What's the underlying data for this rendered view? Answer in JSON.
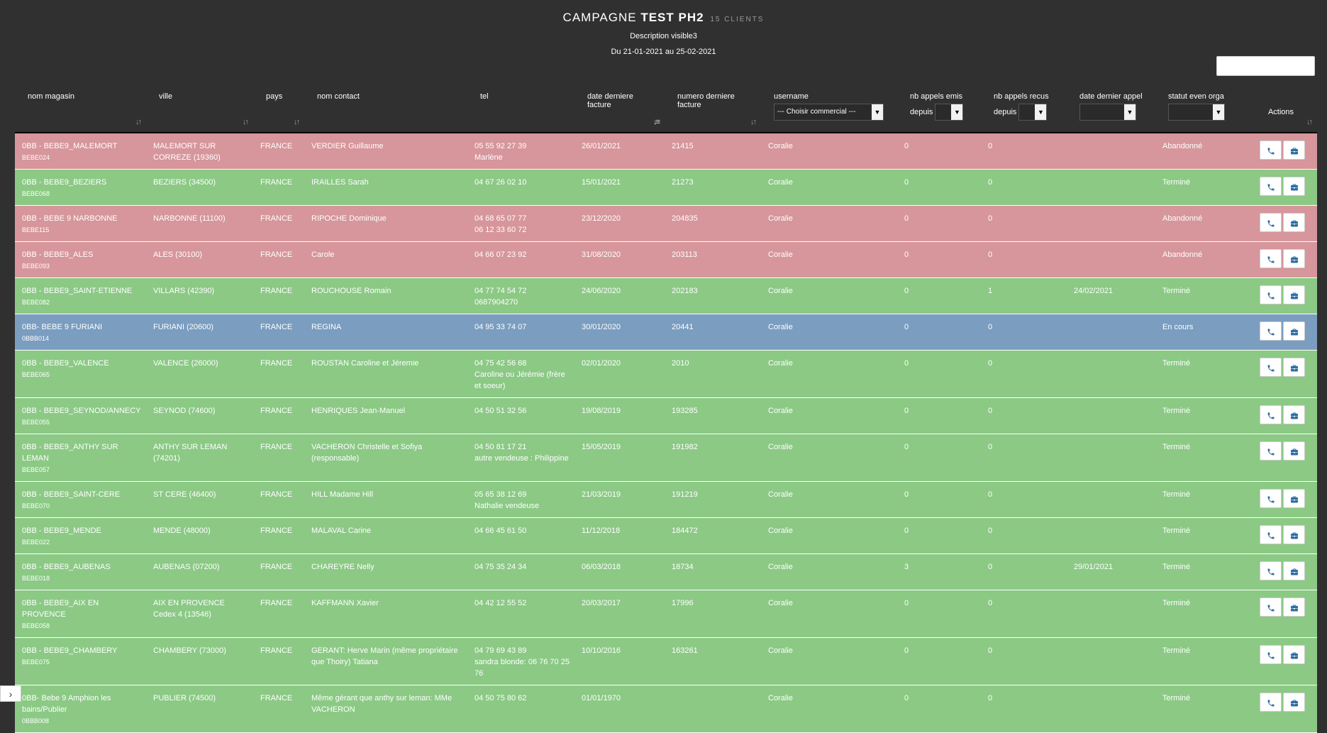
{
  "header": {
    "title_prefix": "CAMPAGNE",
    "title_name": "TEST PH2",
    "count": "15 CLIENTS",
    "description": "Description visible3",
    "dates": "Du 21-01-2021 au 25-02-2021"
  },
  "columns": {
    "nom_magasin": "nom magasin",
    "ville": "ville",
    "pays": "pays",
    "nom_contact": "nom contact",
    "tel": "tel",
    "date_derniere_facture": "date derniere facture",
    "numero_derniere_facture": "numero derniere facture",
    "username": "username",
    "username_select": "--- Choisir commercial ---",
    "nb_appels_emis": "nb appels emis",
    "nb_appels_emis_sub": "depuis",
    "nb_appels_recus": "nb appels recus",
    "nb_appels_recus_sub": "depuis",
    "date_dernier_appel": "date dernier appel",
    "statut": "statut even orga",
    "actions": "Actions"
  },
  "rows": [
    {
      "status": "red",
      "magasin": "0BB - BEBE9_MALEMORT",
      "code": "BEBE024",
      "ville": "MALEMORT SUR CORREZE (19360)",
      "pays": "FRANCE",
      "contact": "VERDIER Guillaume",
      "tel": "05 55 92 27 39",
      "tel2": "Marlène",
      "date_facture": "26/01/2021",
      "num_facture": "21415",
      "username": "Coralie",
      "emis": "0",
      "recus": "0",
      "dernier_appel": "",
      "statut": "Abandonné"
    },
    {
      "status": "green",
      "magasin": "0BB - BEBE9_BEZIERS",
      "code": "BEBE068",
      "ville": "BEZIERS (34500)",
      "pays": "FRANCE",
      "contact": "IRAILLES Sarah",
      "tel": "04 67 26 02 10",
      "tel2": "",
      "date_facture": "15/01/2021",
      "num_facture": "21273",
      "username": "Coralie",
      "emis": "0",
      "recus": "0",
      "dernier_appel": "",
      "statut": "Terminé"
    },
    {
      "status": "red",
      "magasin": "0BB - BEBE 9 NARBONNE",
      "code": "BEBE115",
      "ville": "NARBONNE (11100)",
      "pays": "FRANCE",
      "contact": "RIPOCHE Dominique",
      "tel": "04 68 65 07 77",
      "tel2": "06 12 33 60 72",
      "date_facture": "23/12/2020",
      "num_facture": "204835",
      "username": "Coralie",
      "emis": "0",
      "recus": "0",
      "dernier_appel": "",
      "statut": "Abandonné"
    },
    {
      "status": "red",
      "magasin": "0BB - BEBE9_ALES",
      "code": "BEBE093",
      "ville": "ALES (30100)",
      "pays": "FRANCE",
      "contact": "Carole",
      "tel": "04 66 07 23 92",
      "tel2": "",
      "date_facture": "31/08/2020",
      "num_facture": "203113",
      "username": "Coralie",
      "emis": "0",
      "recus": "0",
      "dernier_appel": "",
      "statut": "Abandonné"
    },
    {
      "status": "green",
      "magasin": "0BB - BEBE9_SAINT-ETIENNE",
      "code": "BEBE082",
      "ville": "VILLARS (42390)",
      "pays": "FRANCE",
      "contact": "ROUCHOUSE Romain",
      "tel": "04 77 74 54 72",
      "tel2": "0687904270",
      "date_facture": "24/06/2020",
      "num_facture": "202183",
      "username": "Coralie",
      "emis": "0",
      "recus": "1",
      "dernier_appel": "24/02/2021",
      "statut": "Terminé"
    },
    {
      "status": "blue",
      "magasin": "0BB- BEBE 9 FURIANI",
      "code": "0BBB014",
      "ville": "FURIANI (20600)",
      "pays": "FRANCE",
      "contact": "REGINA",
      "tel": "04 95 33 74 07",
      "tel2": "",
      "date_facture": "30/01/2020",
      "num_facture": "20441",
      "username": "Coralie",
      "emis": "0",
      "recus": "0",
      "dernier_appel": "",
      "statut": "En cours"
    },
    {
      "status": "green",
      "magasin": "0BB - BEBE9_VALENCE",
      "code": "BEBE065",
      "ville": "VALENCE (26000)",
      "pays": "FRANCE",
      "contact": "ROUSTAN Caroline et Jéremie",
      "tel": "04 75 42 56 68",
      "tel2": "Caroline ou Jérémie (frère et soeur)",
      "date_facture": "02/01/2020",
      "num_facture": "2010",
      "username": "Coralie",
      "emis": "0",
      "recus": "0",
      "dernier_appel": "",
      "statut": "Terminé"
    },
    {
      "status": "green",
      "magasin": "0BB - BEBE9_SEYNOD/ANNECY",
      "code": "BEBE055",
      "ville": "SEYNOD (74600)",
      "pays": "FRANCE",
      "contact": "HENRIQUES Jean-Manuel",
      "tel": "04 50 51 32 56",
      "tel2": "",
      "date_facture": "19/08/2019",
      "num_facture": "193285",
      "username": "Coralie",
      "emis": "0",
      "recus": "0",
      "dernier_appel": "",
      "statut": "Terminé"
    },
    {
      "status": "green",
      "magasin": "0BB - BEBE9_ANTHY SUR LEMAN",
      "code": "BEBE057",
      "ville": "ANTHY SUR LEMAN (74201)",
      "pays": "FRANCE",
      "contact": "VACHERON Christelle et Sofiya (responsable)",
      "tel": "04 50 81 17 21",
      "tel2": "autre vendeuse : Philippine",
      "date_facture": "15/05/2019",
      "num_facture": "191982",
      "username": "Coralie",
      "emis": "0",
      "recus": "0",
      "dernier_appel": "",
      "statut": "Terminé"
    },
    {
      "status": "green",
      "magasin": "0BB - BEBE9_SAINT-CERE",
      "code": "BEBE070",
      "ville": "ST CERE (46400)",
      "pays": "FRANCE",
      "contact": "HILL Madame Hill",
      "tel": "05 65 38 12 69",
      "tel2": "Nathalie vendeuse",
      "date_facture": "21/03/2019",
      "num_facture": "191219",
      "username": "Coralie",
      "emis": "0",
      "recus": "0",
      "dernier_appel": "",
      "statut": "Terminé"
    },
    {
      "status": "green",
      "magasin": "0BB - BEBE9_MENDE",
      "code": "BEBE022",
      "ville": "MENDE (48000)",
      "pays": "FRANCE",
      "contact": "MALAVAL Carine",
      "tel": "04 66 45 61 50",
      "tel2": "",
      "date_facture": "11/12/2018",
      "num_facture": "184472",
      "username": "Coralie",
      "emis": "0",
      "recus": "0",
      "dernier_appel": "",
      "statut": "Terminé"
    },
    {
      "status": "green",
      "magasin": "0BB - BEBE9_AUBENAS",
      "code": "BEBE018",
      "ville": "AUBENAS (07200)",
      "pays": "FRANCE",
      "contact": "CHAREYRE Nelly",
      "tel": "04 75 35 24 34",
      "tel2": "",
      "date_facture": "06/03/2018",
      "num_facture": "18734",
      "username": "Coralie",
      "emis": "3",
      "recus": "0",
      "dernier_appel": "29/01/2021",
      "statut": "Terminé"
    },
    {
      "status": "green",
      "magasin": "0BB - BEBE9_AIX EN PROVENCE",
      "code": "BEBE058",
      "ville": "AIX EN PROVENCE Cedex 4 (13546)",
      "pays": "FRANCE",
      "contact": "KAFFMANN Xavier",
      "tel": "04 42 12 55 52",
      "tel2": "",
      "date_facture": "20/03/2017",
      "num_facture": "17996",
      "username": "Coralie",
      "emis": "0",
      "recus": "0",
      "dernier_appel": "",
      "statut": "Terminé"
    },
    {
      "status": "green",
      "magasin": "0BB - BEBE9_CHAMBERY",
      "code": "BEBE075",
      "ville": "CHAMBERY (73000)",
      "pays": "FRANCE",
      "contact": "GERANT: Herve Marin (même propriétaire que Thoiry) Tatiana",
      "tel": "04 79 69 43 89",
      "tel2": "sandra blonde: 06 76 70 25 76",
      "date_facture": "10/10/2016",
      "num_facture": "163261",
      "username": "Coralie",
      "emis": "0",
      "recus": "0",
      "dernier_appel": "",
      "statut": "Terminé"
    },
    {
      "status": "green",
      "magasin": "0BB- Bebe 9 Amphion les bains/Publier",
      "code": "0BBB008",
      "ville": "PUBLIER (74500)",
      "pays": "FRANCE",
      "contact": "Même gérant que anthy sur leman: MMe VACHERON",
      "tel": "04 50 75 80 62",
      "tel2": "",
      "date_facture": "01/01/1970",
      "num_facture": "",
      "username": "Coralie",
      "emis": "0",
      "recus": "0",
      "dernier_appel": "",
      "statut": "Terminé"
    }
  ],
  "icons": {
    "call": "phone-icon",
    "case": "briefcase-icon",
    "sort": "sort-icon",
    "sidebar_toggle": "chevron-right-icon"
  },
  "colors": {
    "red_row": "#d6969b",
    "green_row": "#8bc985",
    "blue_row": "#7a9dc0",
    "background": "#303030"
  }
}
